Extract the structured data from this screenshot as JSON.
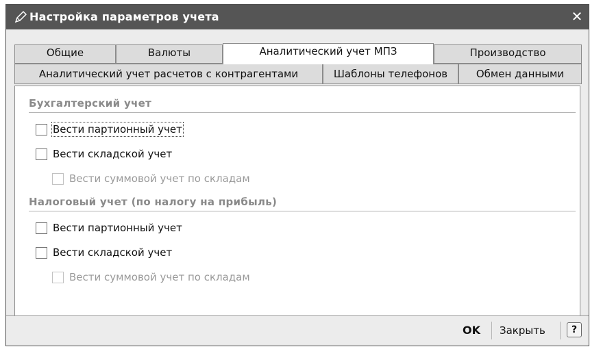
{
  "window": {
    "title": "Настройка параметров учета",
    "title_icon": "pencil-icon",
    "close_glyph": "✕"
  },
  "tabs": {
    "row1": [
      "Общие",
      "Валюты",
      "Аналитический учет МПЗ",
      "Производство"
    ],
    "row2": [
      "Аналитический учет расчетов с контрагентами",
      "Шаблоны телефонов",
      "Обмен данными"
    ],
    "active": "Аналитический учет МПЗ"
  },
  "accounting": {
    "title": "Бухгалтерский учет",
    "batch": "Вести партионный учет",
    "warehouse": "Вести складской учет",
    "sum_by_warehouse": "Вести суммовой учет по складам"
  },
  "tax": {
    "title": "Налоговый учет (по налогу на прибыль)",
    "batch": "Вести партионный учет",
    "warehouse": "Вести складской учет",
    "sum_by_warehouse": "Вести суммовой учет по складам"
  },
  "footer": {
    "ok": "OK",
    "close": "Закрыть",
    "help": "?"
  },
  "colors": {
    "titlebar": "#555555",
    "disabled_text": "#9a9a9a",
    "section_title": "#8a8a8a"
  }
}
